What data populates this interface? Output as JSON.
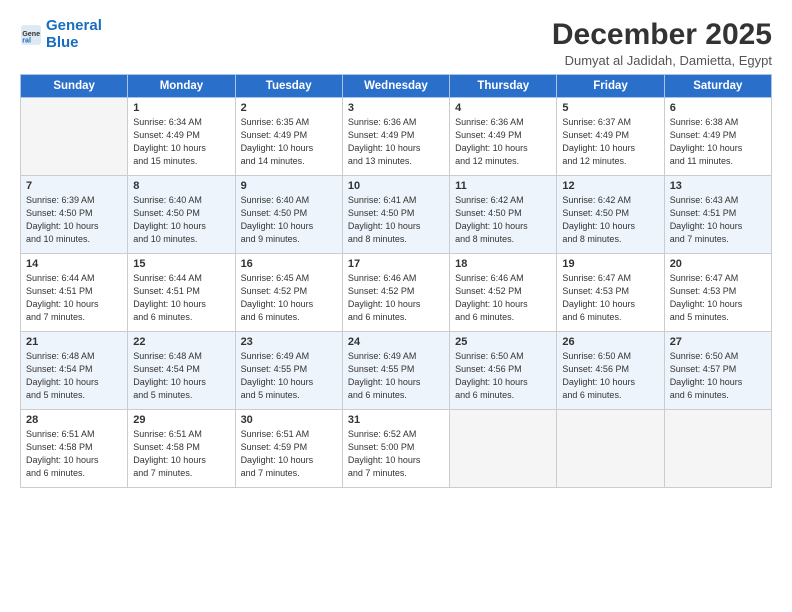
{
  "logo": {
    "line1": "General",
    "line2": "Blue"
  },
  "title": "December 2025",
  "location": "Dumyat al Jadidah, Damietta, Egypt",
  "days_of_week": [
    "Sunday",
    "Monday",
    "Tuesday",
    "Wednesday",
    "Thursday",
    "Friday",
    "Saturday"
  ],
  "weeks": [
    [
      {
        "day": "",
        "info": ""
      },
      {
        "day": "1",
        "info": "Sunrise: 6:34 AM\nSunset: 4:49 PM\nDaylight: 10 hours\nand 15 minutes."
      },
      {
        "day": "2",
        "info": "Sunrise: 6:35 AM\nSunset: 4:49 PM\nDaylight: 10 hours\nand 14 minutes."
      },
      {
        "day": "3",
        "info": "Sunrise: 6:36 AM\nSunset: 4:49 PM\nDaylight: 10 hours\nand 13 minutes."
      },
      {
        "day": "4",
        "info": "Sunrise: 6:36 AM\nSunset: 4:49 PM\nDaylight: 10 hours\nand 12 minutes."
      },
      {
        "day": "5",
        "info": "Sunrise: 6:37 AM\nSunset: 4:49 PM\nDaylight: 10 hours\nand 12 minutes."
      },
      {
        "day": "6",
        "info": "Sunrise: 6:38 AM\nSunset: 4:49 PM\nDaylight: 10 hours\nand 11 minutes."
      }
    ],
    [
      {
        "day": "7",
        "info": "Sunrise: 6:39 AM\nSunset: 4:50 PM\nDaylight: 10 hours\nand 10 minutes."
      },
      {
        "day": "8",
        "info": "Sunrise: 6:40 AM\nSunset: 4:50 PM\nDaylight: 10 hours\nand 10 minutes."
      },
      {
        "day": "9",
        "info": "Sunrise: 6:40 AM\nSunset: 4:50 PM\nDaylight: 10 hours\nand 9 minutes."
      },
      {
        "day": "10",
        "info": "Sunrise: 6:41 AM\nSunset: 4:50 PM\nDaylight: 10 hours\nand 8 minutes."
      },
      {
        "day": "11",
        "info": "Sunrise: 6:42 AM\nSunset: 4:50 PM\nDaylight: 10 hours\nand 8 minutes."
      },
      {
        "day": "12",
        "info": "Sunrise: 6:42 AM\nSunset: 4:50 PM\nDaylight: 10 hours\nand 8 minutes."
      },
      {
        "day": "13",
        "info": "Sunrise: 6:43 AM\nSunset: 4:51 PM\nDaylight: 10 hours\nand 7 minutes."
      }
    ],
    [
      {
        "day": "14",
        "info": "Sunrise: 6:44 AM\nSunset: 4:51 PM\nDaylight: 10 hours\nand 7 minutes."
      },
      {
        "day": "15",
        "info": "Sunrise: 6:44 AM\nSunset: 4:51 PM\nDaylight: 10 hours\nand 6 minutes."
      },
      {
        "day": "16",
        "info": "Sunrise: 6:45 AM\nSunset: 4:52 PM\nDaylight: 10 hours\nand 6 minutes."
      },
      {
        "day": "17",
        "info": "Sunrise: 6:46 AM\nSunset: 4:52 PM\nDaylight: 10 hours\nand 6 minutes."
      },
      {
        "day": "18",
        "info": "Sunrise: 6:46 AM\nSunset: 4:52 PM\nDaylight: 10 hours\nand 6 minutes."
      },
      {
        "day": "19",
        "info": "Sunrise: 6:47 AM\nSunset: 4:53 PM\nDaylight: 10 hours\nand 6 minutes."
      },
      {
        "day": "20",
        "info": "Sunrise: 6:47 AM\nSunset: 4:53 PM\nDaylight: 10 hours\nand 5 minutes."
      }
    ],
    [
      {
        "day": "21",
        "info": "Sunrise: 6:48 AM\nSunset: 4:54 PM\nDaylight: 10 hours\nand 5 minutes."
      },
      {
        "day": "22",
        "info": "Sunrise: 6:48 AM\nSunset: 4:54 PM\nDaylight: 10 hours\nand 5 minutes."
      },
      {
        "day": "23",
        "info": "Sunrise: 6:49 AM\nSunset: 4:55 PM\nDaylight: 10 hours\nand 5 minutes."
      },
      {
        "day": "24",
        "info": "Sunrise: 6:49 AM\nSunset: 4:55 PM\nDaylight: 10 hours\nand 6 minutes."
      },
      {
        "day": "25",
        "info": "Sunrise: 6:50 AM\nSunset: 4:56 PM\nDaylight: 10 hours\nand 6 minutes."
      },
      {
        "day": "26",
        "info": "Sunrise: 6:50 AM\nSunset: 4:56 PM\nDaylight: 10 hours\nand 6 minutes."
      },
      {
        "day": "27",
        "info": "Sunrise: 6:50 AM\nSunset: 4:57 PM\nDaylight: 10 hours\nand 6 minutes."
      }
    ],
    [
      {
        "day": "28",
        "info": "Sunrise: 6:51 AM\nSunset: 4:58 PM\nDaylight: 10 hours\nand 6 minutes."
      },
      {
        "day": "29",
        "info": "Sunrise: 6:51 AM\nSunset: 4:58 PM\nDaylight: 10 hours\nand 7 minutes."
      },
      {
        "day": "30",
        "info": "Sunrise: 6:51 AM\nSunset: 4:59 PM\nDaylight: 10 hours\nand 7 minutes."
      },
      {
        "day": "31",
        "info": "Sunrise: 6:52 AM\nSunset: 5:00 PM\nDaylight: 10 hours\nand 7 minutes."
      },
      {
        "day": "",
        "info": ""
      },
      {
        "day": "",
        "info": ""
      },
      {
        "day": "",
        "info": ""
      }
    ]
  ]
}
